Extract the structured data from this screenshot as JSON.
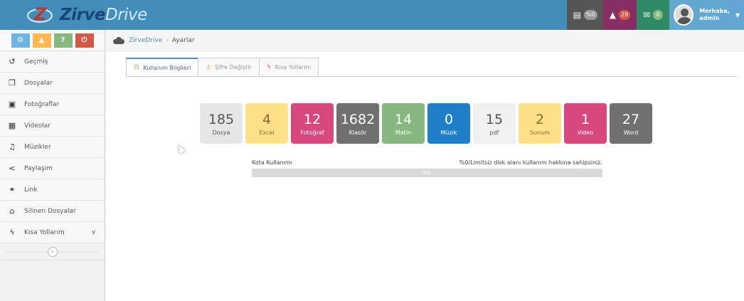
{
  "brand": {
    "logo_letter": "Z",
    "name_bold": "Zirve",
    "name_light": "Drive"
  },
  "navbar": {
    "storage_badge": "%0",
    "notifications_count": "29",
    "messages_count": "0",
    "user_greeting": "Merhaba,",
    "user_name": "admin"
  },
  "shortcuts": [
    {
      "label": "⚙",
      "icon": "cogs-icon"
    },
    {
      "label": "▲",
      "icon": "warning-icon"
    },
    {
      "label": "?",
      "icon": "question-icon"
    },
    {
      "label": "⏻",
      "icon": "power-icon"
    }
  ],
  "sidebar": {
    "items": [
      {
        "label": "Geçmiş",
        "icon": "history-icon"
      },
      {
        "label": "Dosyalar",
        "icon": "files-icon"
      },
      {
        "label": "Fotoğraflar",
        "icon": "picture-icon"
      },
      {
        "label": "Videolar",
        "icon": "film-icon"
      },
      {
        "label": "Müzikler",
        "icon": "music-icon"
      },
      {
        "label": "Paylaşım",
        "icon": "share-icon"
      },
      {
        "label": "Link",
        "icon": "link-icon"
      },
      {
        "label": "Silinen Dosyalar",
        "icon": "trash-icon"
      },
      {
        "label": "Kısa Yollarım",
        "icon": "bolt-icon"
      }
    ],
    "collapse_label": "«"
  },
  "breadcrumb": {
    "home": "ZirveDrive",
    "current": "Ayarlar"
  },
  "tabs": [
    {
      "label": "Kullanım Bilgileri",
      "icon": "hdd-icon",
      "active": true
    },
    {
      "label": "Şifre Değiştir",
      "icon": "key-icon",
      "active": false
    },
    {
      "label": "Kısa Yollarım",
      "icon": "bolt-icon",
      "active": false
    }
  ],
  "stats": [
    {
      "value": "185",
      "label": "Dosya",
      "color": "#e6e6e6"
    },
    {
      "value": "4",
      "label": "Excel",
      "color": "#fee188"
    },
    {
      "value": "12",
      "label": "Fotoğraf",
      "color": "#d6487e"
    },
    {
      "value": "1682",
      "label": "Klasör",
      "color": "#707070"
    },
    {
      "value": "14",
      "label": "Metin",
      "color": "#87b87f"
    },
    {
      "value": "0",
      "label": "Müzik",
      "color": "#1f7ec8"
    },
    {
      "value": "15",
      "label": "pdf",
      "color": "#f0f0f0"
    },
    {
      "value": "2",
      "label": "Sunum",
      "color": "#fee188"
    },
    {
      "value": "1",
      "label": "Video",
      "color": "#d6487e"
    },
    {
      "value": "27",
      "label": "Word",
      "color": "#707070"
    }
  ],
  "quota": {
    "label": "Kota Kullanımı",
    "info": "%0/Limitsiz disk alanı kullanım hakkına sahipsiniz.",
    "percent_text": "0%",
    "percent": 0
  }
}
